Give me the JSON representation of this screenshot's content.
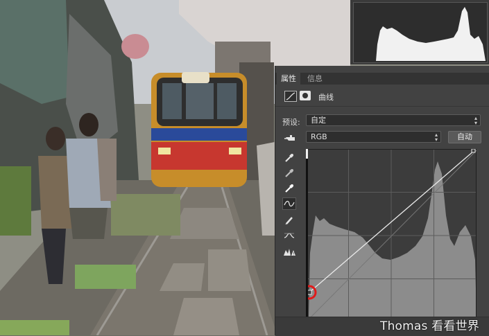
{
  "panel": {
    "tabs": [
      "属性",
      "信息"
    ],
    "adjustment_title": "曲线",
    "preset_label": "预设:",
    "preset_value": "自定",
    "channel_value": "RGB",
    "auto_button": "自动",
    "collapse_glyph": "◂◂"
  },
  "tools": [
    "on-image-adjust-icon",
    "sample-shadows-eyedropper-icon",
    "sample-midtones-eyedropper-icon",
    "sample-highlights-eyedropper-icon",
    "edit-points-curve-icon",
    "draw-pencil-icon",
    "smooth-curve-icon",
    "clipping-warning-icon"
  ],
  "watermark": "Thomas 看看世界",
  "colors": {
    "panel_bg": "#424242",
    "graph_bg": "#3a3a3a",
    "histogram": "#8c8c8c",
    "highlight_circle": "#e01a1a"
  }
}
